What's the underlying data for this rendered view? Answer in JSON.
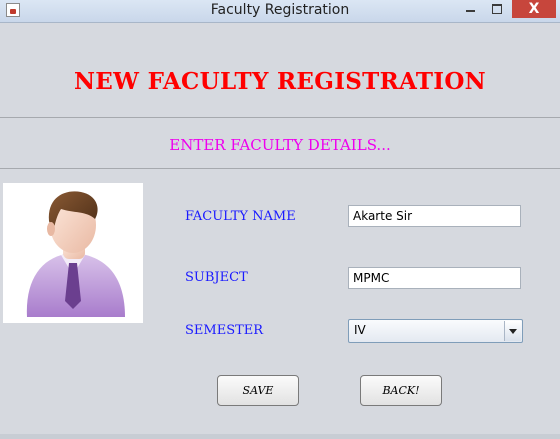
{
  "window": {
    "title": "Faculty Registration",
    "close_symbol": "X"
  },
  "form": {
    "heading": "NEW FACULTY REGISTRATION",
    "subheading": "ENTER FACULTY DETAILS...",
    "fields": [
      {
        "label": "FACULTY NAME",
        "value": "Akarte Sir"
      },
      {
        "label": "SUBJECT",
        "value": "MPMC"
      }
    ],
    "semester": {
      "label": "SEMESTER",
      "selected": "IV"
    },
    "buttons": {
      "save": "SAVE",
      "back": "BACK!"
    }
  },
  "colors": {
    "heading": "#ff0000",
    "subheading": "#ee00ee",
    "labels": "#1a1aff",
    "background": "#d6d9df"
  },
  "icons": [
    "java-app-icon",
    "minimize-icon",
    "maximize-icon",
    "close-icon",
    "faculty-avatar-icon",
    "dropdown-arrow-icon"
  ]
}
